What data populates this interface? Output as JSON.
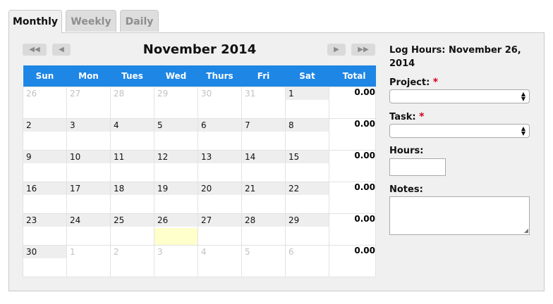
{
  "tabs": [
    {
      "label": "Monthly",
      "active": true
    },
    {
      "label": "Weekly",
      "active": false
    },
    {
      "label": "Daily",
      "active": false
    }
  ],
  "nav": {
    "prev_year": "◀◀",
    "prev_month": "◀",
    "next_month": "▶",
    "next_year": "▶▶"
  },
  "calendar": {
    "title": "November 2014",
    "headers": [
      "Sun",
      "Mon",
      "Tues",
      "Wed",
      "Thurs",
      "Fri",
      "Sat",
      "Total"
    ],
    "weeks": [
      {
        "days": [
          {
            "n": "26",
            "other": true
          },
          {
            "n": "27",
            "other": true
          },
          {
            "n": "28",
            "other": true
          },
          {
            "n": "29",
            "other": true
          },
          {
            "n": "30",
            "other": true
          },
          {
            "n": "31",
            "other": true
          },
          {
            "n": "1",
            "other": false
          }
        ],
        "total": "0.00"
      },
      {
        "days": [
          {
            "n": "2",
            "other": false
          },
          {
            "n": "3",
            "other": false
          },
          {
            "n": "4",
            "other": false
          },
          {
            "n": "5",
            "other": false
          },
          {
            "n": "6",
            "other": false
          },
          {
            "n": "7",
            "other": false
          },
          {
            "n": "8",
            "other": false
          }
        ],
        "total": "0.00"
      },
      {
        "days": [
          {
            "n": "9",
            "other": false
          },
          {
            "n": "10",
            "other": false
          },
          {
            "n": "11",
            "other": false
          },
          {
            "n": "12",
            "other": false
          },
          {
            "n": "13",
            "other": false
          },
          {
            "n": "14",
            "other": false
          },
          {
            "n": "15",
            "other": false
          }
        ],
        "total": "0.00"
      },
      {
        "days": [
          {
            "n": "16",
            "other": false
          },
          {
            "n": "17",
            "other": false
          },
          {
            "n": "18",
            "other": false
          },
          {
            "n": "19",
            "other": false
          },
          {
            "n": "20",
            "other": false
          },
          {
            "n": "21",
            "other": false
          },
          {
            "n": "22",
            "other": false
          }
        ],
        "total": "0.00"
      },
      {
        "days": [
          {
            "n": "23",
            "other": false
          },
          {
            "n": "24",
            "other": false
          },
          {
            "n": "25",
            "other": false
          },
          {
            "n": "26",
            "other": false,
            "today": true
          },
          {
            "n": "27",
            "other": false
          },
          {
            "n": "28",
            "other": false
          },
          {
            "n": "29",
            "other": false
          }
        ],
        "total": "0.00"
      },
      {
        "days": [
          {
            "n": "30",
            "other": false
          },
          {
            "n": "1",
            "other": true
          },
          {
            "n": "2",
            "other": true
          },
          {
            "n": "3",
            "other": true
          },
          {
            "n": "4",
            "other": true
          },
          {
            "n": "5",
            "other": true
          },
          {
            "n": "6",
            "other": true
          }
        ],
        "total": "0.00"
      }
    ]
  },
  "log": {
    "title": "Log Hours: November 26, 2014",
    "project_label": "Project:",
    "task_label": "Task:",
    "hours_label": "Hours:",
    "notes_label": "Notes:",
    "required_mark": "*",
    "project_value": "",
    "task_value": "",
    "hours_value": "",
    "notes_value": ""
  },
  "colors": {
    "header_blue": "#1e86e5",
    "today_fill": "#ffffcc",
    "required": "#d0021b"
  }
}
